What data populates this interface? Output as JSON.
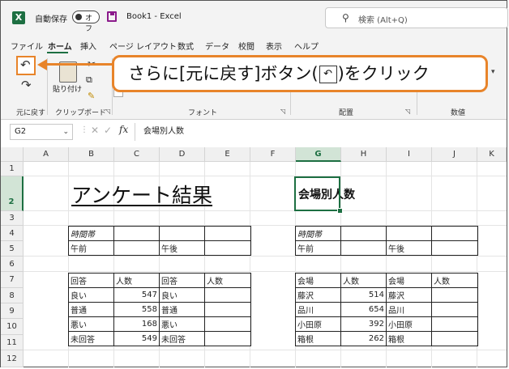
{
  "titlebar": {
    "app_logo": "X",
    "autosave_label": "自動保存",
    "autosave_state": "オフ",
    "doc_title": "Book1  -  Excel",
    "search_placeholder": "検索 (Alt+Q)"
  },
  "ribbon_tabs": [
    "ファイル",
    "ホーム",
    "挿入",
    "ページ レイアウト",
    "数式",
    "データ",
    "校閲",
    "表示",
    "ヘルプ"
  ],
  "ribbon": {
    "paste_label": "貼り付け",
    "groups": {
      "undo": "元に戻す",
      "clipboard": "クリップボード",
      "font": "フォント",
      "alignment": "配置",
      "number": "数値"
    }
  },
  "callout": {
    "text_before": "さらに[元に戻す]ボタン(",
    "icon": "undo-icon",
    "text_after": ")をクリック"
  },
  "formula_bar": {
    "name_box": "G2",
    "fx": "fx",
    "content": "会場別人数"
  },
  "columns": [
    "A",
    "B",
    "C",
    "D",
    "E",
    "F",
    "G",
    "H",
    "I",
    "J",
    "K"
  ],
  "rows": [
    "1",
    "2",
    "3",
    "4",
    "5",
    "6",
    "7",
    "8",
    "9",
    "10",
    "11",
    "12"
  ],
  "cells": {
    "B2": "アンケート結果",
    "G2": "会場別人数"
  },
  "left_table_time": {
    "rows": [
      [
        "時間帯",
        "",
        "",
        ""
      ],
      [
        "午前",
        "",
        "午後",
        ""
      ]
    ]
  },
  "left_table_answers": {
    "header": [
      "回答",
      "人数",
      "回答",
      "人数"
    ],
    "rows": [
      [
        "良い",
        "547",
        "良い",
        ""
      ],
      [
        "普通",
        "558",
        "普通",
        ""
      ],
      [
        "悪い",
        "168",
        "悪い",
        ""
      ],
      [
        "未回答",
        "549",
        "未回答",
        ""
      ]
    ]
  },
  "right_table_time": {
    "rows": [
      [
        "時間帯",
        "",
        "",
        ""
      ],
      [
        "午前",
        "",
        "午後",
        ""
      ]
    ]
  },
  "right_table_venues": {
    "header": [
      "会場",
      "人数",
      "会場",
      "人数"
    ],
    "rows": [
      [
        "藤沢",
        "514",
        "藤沢",
        ""
      ],
      [
        "品川",
        "654",
        "品川",
        ""
      ],
      [
        "小田原",
        "392",
        "小田原",
        ""
      ],
      [
        "箱根",
        "262",
        "箱根",
        ""
      ]
    ]
  },
  "colors": {
    "accent_green": "#1d6f42",
    "callout_orange": "#e8842a"
  }
}
